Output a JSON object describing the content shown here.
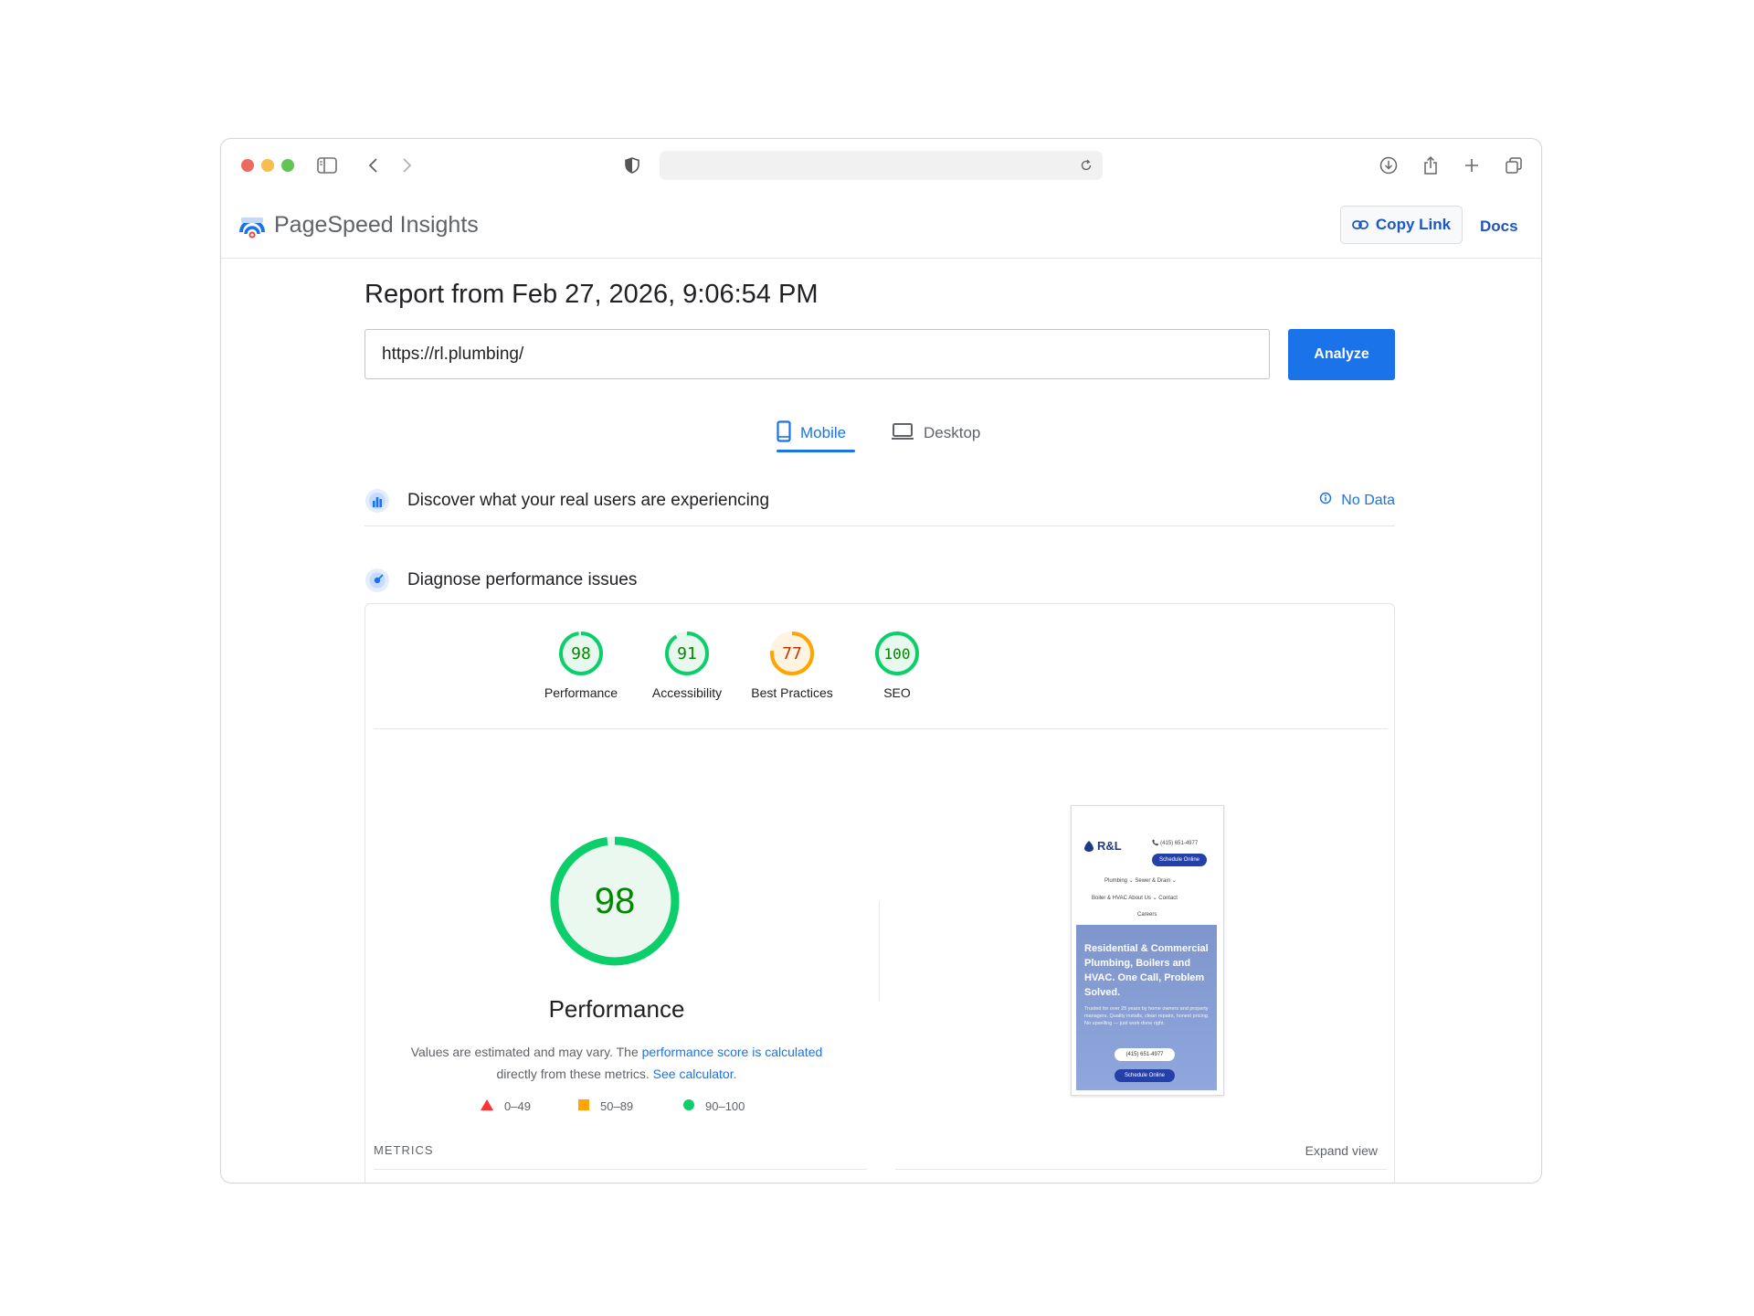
{
  "app": {
    "name": "PageSpeed Insights",
    "copy_link": "Copy Link",
    "docs": "Docs"
  },
  "report": {
    "title": "Report from Feb 27, 2026, 9:06:54 PM",
    "url_value": "https://rl.plumbing/",
    "analyze_label": "Analyze"
  },
  "tabs": {
    "mobile": "Mobile",
    "desktop": "Desktop",
    "active": "Mobile"
  },
  "sections": {
    "real_users": "Discover what your real users are experiencing",
    "no_data": "No Data",
    "diagnose": "Diagnose performance issues"
  },
  "scores": [
    {
      "label": "Performance",
      "value": "98",
      "score": 98,
      "color": "#0cce6b",
      "text_color": "#008800",
      "bg": "#e8f8ee"
    },
    {
      "label": "Accessibility",
      "value": "91",
      "score": 91,
      "color": "#0cce6b",
      "text_color": "#008800",
      "bg": "#e8f8ee"
    },
    {
      "label": "Best Practices",
      "value": "77",
      "score": 77,
      "color": "#ffa400",
      "text_color": "#c33300",
      "bg": "#fff4e2"
    },
    {
      "label": "SEO",
      "value": "100",
      "score": 100,
      "color": "#0cce6b",
      "text_color": "#008800",
      "bg": "#e8f8ee"
    }
  ],
  "performance": {
    "score": "98",
    "title": "Performance",
    "note_pre": "Values are estimated and may vary. The ",
    "note_link1": "performance score is calculated",
    "note_mid": " directly from these metrics. ",
    "note_link2": "See calculator."
  },
  "legend": [
    {
      "range": "0–49",
      "shape": "triangle",
      "color": "#ff3333"
    },
    {
      "range": "50–89",
      "shape": "square",
      "color": "#ffa400"
    },
    {
      "range": "90–100",
      "shape": "circle",
      "color": "#0cce6b"
    }
  ],
  "metrics_label": "METRICS",
  "expand_view": "Expand view",
  "thumbnail": {
    "logo": "R&L",
    "phone": "(415) 651-4977",
    "schedule": "Schedule Online",
    "nav1": "Plumbing ⌄     Sewer & Drain ⌄",
    "nav2": "Boiler & HVAC     About Us ⌄     Contact",
    "nav3": "Careers",
    "hero_title": "Residential & Commercial Plumbing, Boilers and HVAC. One Call, Problem Solved.",
    "hero_sub": "Trusted for over 25 years by home owners and property managers. Quality installs, clean repairs, honest pricing. No upselling — just work done right.",
    "phone_btn": "(415) 651-4977",
    "schedule_btn": "Schedule Online"
  },
  "colors": {
    "accent": "#1a73e8",
    "pass": "#0cce6b",
    "average": "#ffa400",
    "fail": "#ff3333"
  }
}
